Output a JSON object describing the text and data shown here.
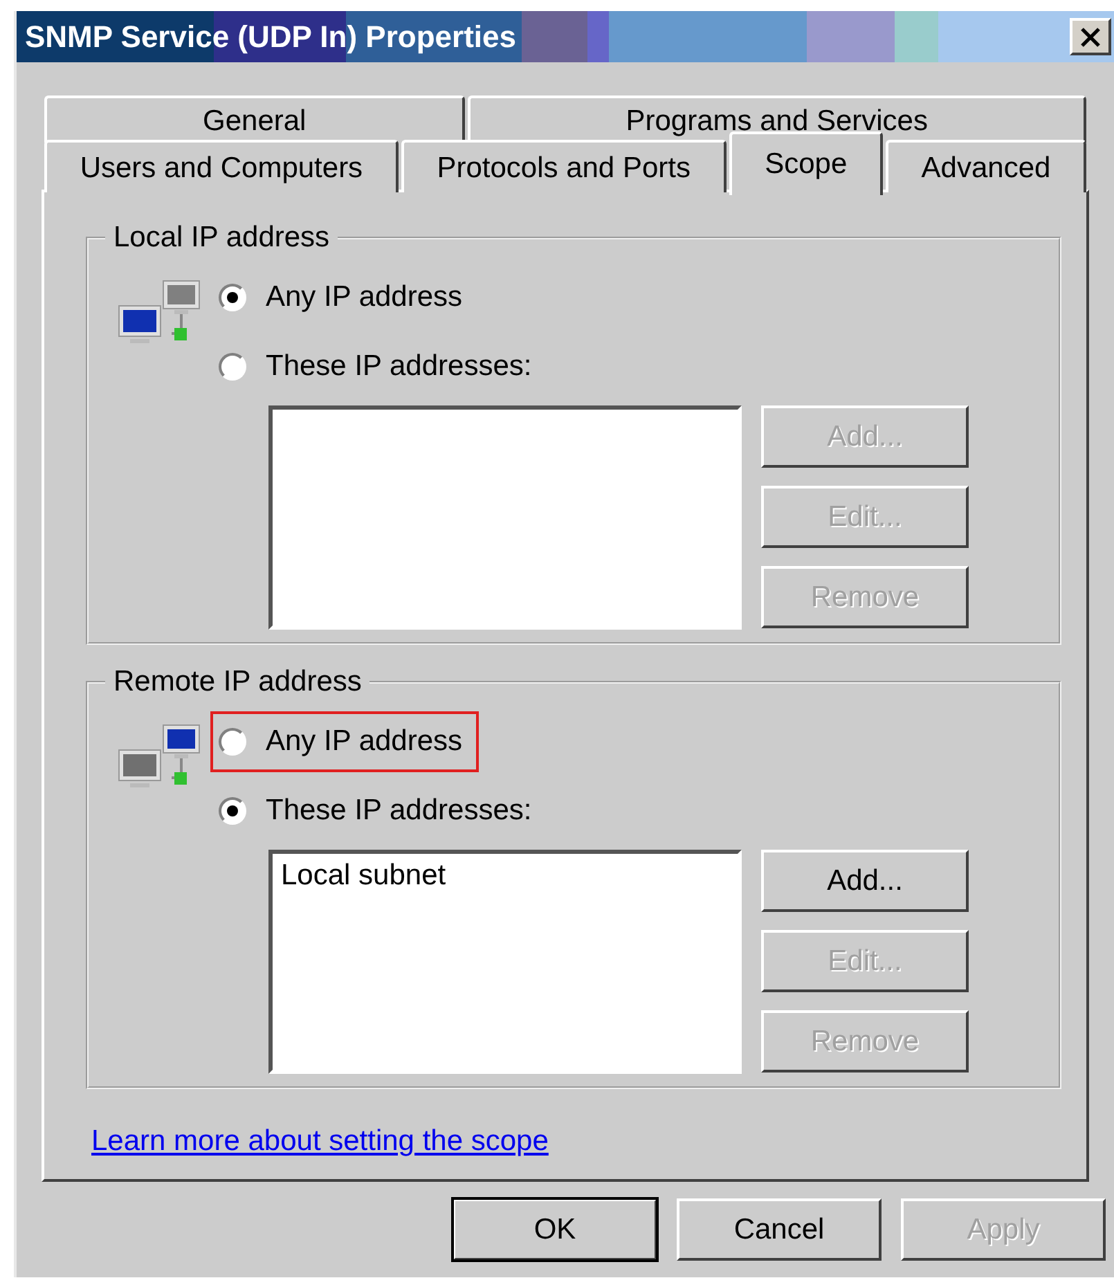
{
  "window": {
    "title": "SNMP Service (UDP In) Properties"
  },
  "tab_rows": [
    {
      "tabs": [
        {
          "label": "General",
          "selected": false
        },
        {
          "label": "Programs and Services",
          "selected": false
        }
      ]
    },
    {
      "tabs": [
        {
          "label": "Users and Computers",
          "selected": false
        },
        {
          "label": "Protocols and Ports",
          "selected": false
        },
        {
          "label": "Scope",
          "selected": true
        },
        {
          "label": "Advanced",
          "selected": false
        }
      ]
    }
  ],
  "groups": [
    {
      "legend": "Local IP address",
      "kind": "local",
      "options": [
        {
          "label": "Any IP address",
          "selected": true,
          "highlighted": false
        },
        {
          "label": "These IP addresses:",
          "selected": false,
          "highlighted": false
        }
      ],
      "buttons": [
        {
          "label": "Add...",
          "disabled": true
        },
        {
          "label": "Edit...",
          "disabled": true
        },
        {
          "label": "Remove",
          "disabled": true
        }
      ]
    },
    {
      "legend": "Remote IP address",
      "kind": "remote",
      "options": [
        {
          "label": "Any IP address",
          "selected": false,
          "highlighted": true
        },
        {
          "label": "These IP addresses:",
          "selected": true,
          "highlighted": false
        }
      ],
      "addresses": [
        "Local subnet"
      ],
      "buttons": [
        {
          "label": "Add...",
          "disabled": false
        },
        {
          "label": "Edit...",
          "disabled": true
        },
        {
          "label": "Remove",
          "disabled": true
        }
      ]
    }
  ],
  "link": "Learn more about setting the scope",
  "buttons": [
    {
      "label": "OK",
      "disabled": false,
      "default": true
    },
    {
      "label": "Cancel",
      "disabled": false,
      "default": false
    },
    {
      "label": "Apply",
      "disabled": true,
      "default": false
    }
  ]
}
